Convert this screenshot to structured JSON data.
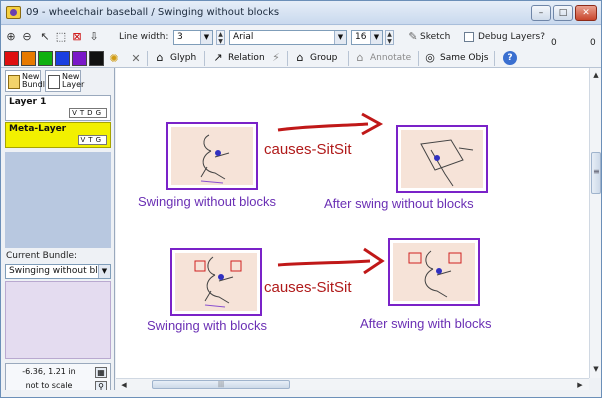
{
  "window": {
    "title": "09 - wheelchair baseball / Swinging without blocks",
    "minimize": "–",
    "maximize": "□",
    "close": "✕"
  },
  "toolbar": {
    "line_width_label": "Line width:",
    "line_width_value": "3",
    "font_value": "Arial",
    "font_size_value": "16",
    "sketch_label": "Sketch",
    "debug_layers_label": "Debug Layers?",
    "zoom_left_value": "0",
    "zoom_right_value": "0",
    "glyph_label": "Glyph",
    "relation_label": "Relation",
    "group_label": "Group",
    "annotate_label": "Annotate",
    "same_objs_label": "Same Objs",
    "help_label": "?",
    "colors": [
      "#e01010",
      "#e87a00",
      "#10b010",
      "#1a3fe0",
      "#7a18c8",
      "#111111"
    ]
  },
  "left_panel": {
    "new_bundle_label": "New Bundle",
    "new_layer_label": "New Layer",
    "layers": [
      {
        "name": "Layer 1",
        "flags": "VTDG"
      },
      {
        "name": "Meta-Layer",
        "flags": "VTG"
      }
    ],
    "current_bundle_label": "Current Bundle:",
    "current_bundle_value": "Swinging without bl",
    "coords": "-6.36, 1.21 in",
    "scale": "not to scale"
  },
  "canvas": {
    "row1_left_caption": "Swinging without blocks",
    "row1_relation": "causes-SitSit",
    "row1_right_caption": "After swing without blocks",
    "row2_left_caption": "Swinging with blocks",
    "row2_relation": "causes-SitSit",
    "row2_right_caption": "After swing with blocks"
  },
  "scrollbar": {
    "hthumb_grip": "|||",
    "vthumb_grip": "≡"
  }
}
